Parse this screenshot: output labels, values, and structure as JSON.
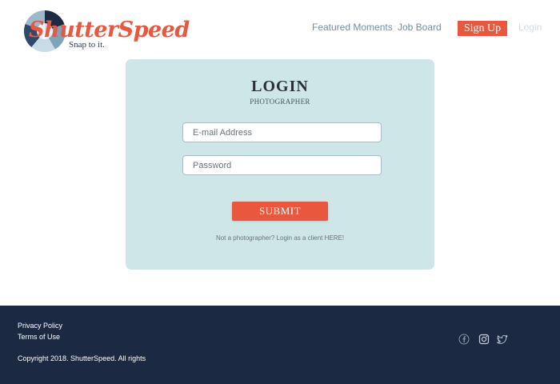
{
  "brand": {
    "name": "ShutterSpeed",
    "tagline": "Snap to it.",
    "accent_color": "#e8573e",
    "footer_color": "#1b2942",
    "card_color": "#cfe6e9"
  },
  "nav": {
    "featured": "Featured Moments",
    "jobs": "Job Board",
    "signup": "Sign Up",
    "login": "Login"
  },
  "login_card": {
    "title": "LOGIN",
    "subtitle": "PHOTOGRAPHER",
    "email_placeholder": "E-mail Address",
    "password_placeholder": "Password",
    "email_value": "",
    "password_value": "",
    "submit_label": "SUBMIT",
    "client_note": "Not a photographer? Login as a client HERE!"
  },
  "footer": {
    "privacy": "Privacy Policy",
    "terms": "Terms of Use",
    "copyright": "Copyright 2018. ShutterSpeed. All rights",
    "social_icons": [
      "facebook-icon",
      "instagram-icon",
      "twitter-icon"
    ]
  }
}
